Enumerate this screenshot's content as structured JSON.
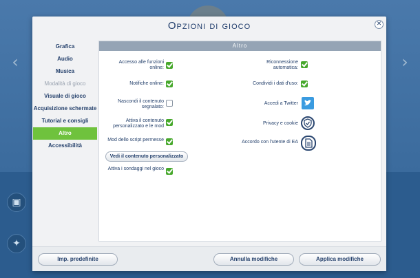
{
  "dialog": {
    "title": "Opzioni di gioco",
    "close_glyph": "✕"
  },
  "sidebar": {
    "items": [
      {
        "label": "Grafica",
        "state": "normal"
      },
      {
        "label": "Audio",
        "state": "normal"
      },
      {
        "label": "Musica",
        "state": "normal"
      },
      {
        "label": "Modalità di gioco",
        "state": "disabled"
      },
      {
        "label": "Visuale di gioco",
        "state": "normal"
      },
      {
        "label": "Acquisizione schermate",
        "state": "normal"
      },
      {
        "label": "Tutorial e consigli",
        "state": "normal"
      },
      {
        "label": "Altro",
        "state": "active"
      },
      {
        "label": "Accessibilità",
        "state": "normal"
      }
    ]
  },
  "panel": {
    "header": "Altro",
    "left_options": [
      {
        "label": "Accesso alle funzioni online:",
        "checked": true
      },
      {
        "label": "Notifiche online:",
        "checked": true
      },
      {
        "label": "Nascondi il contenuto segnalato:",
        "checked": false
      },
      {
        "label": "Attiva il contenuto personalizzato e le mod",
        "checked": true
      },
      {
        "label": "Mod dello script permesse",
        "checked": true
      },
      {
        "label": "Attiva i sondaggi nel gioco",
        "checked": true
      }
    ],
    "view_custom_content_button": "Vedi il contenuto personalizzato",
    "right_options": [
      {
        "label": "Riconnessione automatica:",
        "checked": true
      },
      {
        "label": "Condividi i dati d'uso:",
        "checked": true
      }
    ],
    "links": [
      {
        "label": "Accedi a Twitter",
        "icon": "twitter-icon"
      },
      {
        "label": "Privacy e cookie",
        "icon": "privacy-shield-icon"
      },
      {
        "label": "Accordo con l'utente di EA",
        "icon": "document-icon"
      }
    ]
  },
  "footer": {
    "defaults_button": "Imp. predefinite",
    "cancel_button": "Annulla modifiche",
    "apply_button": "Applica modifiche"
  },
  "colors": {
    "accent_active": "#6fc23d",
    "checkbox_on": "#47a82c",
    "text_primary": "#25416c",
    "panel_header": "#95a4b5"
  }
}
